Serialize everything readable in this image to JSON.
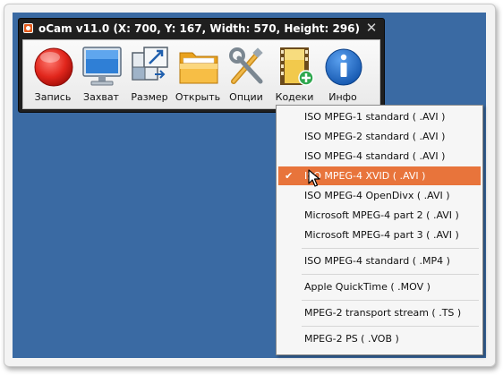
{
  "window": {
    "title": "oCam v11.0 (X: 700, Y: 167, Width: 570, Height: 296)",
    "close_glyph": "✕"
  },
  "toolbar": {
    "buttons": [
      {
        "label": "Запись",
        "icon": "record-icon"
      },
      {
        "label": "Захват",
        "icon": "monitor-icon"
      },
      {
        "label": "Размер",
        "icon": "resize-icon"
      },
      {
        "label": "Открыть",
        "icon": "folder-icon"
      },
      {
        "label": "Опции",
        "icon": "tools-icon"
      },
      {
        "label": "Кодеки",
        "icon": "codec-film-icon"
      },
      {
        "label": "Инфо",
        "icon": "info-icon"
      }
    ]
  },
  "codec_menu": {
    "check_glyph": "✔",
    "items": [
      {
        "label": "ISO MPEG-1 standard ( .AVI )",
        "selected": false
      },
      {
        "label": "ISO MPEG-2 standard ( .AVI )",
        "selected": false
      },
      {
        "label": "ISO MPEG-4 standard ( .AVI )",
        "selected": false
      },
      {
        "label": "ISO MPEG-4 XVID ( .AVI )",
        "selected": true
      },
      {
        "label": "ISO MPEG-4 OpenDivx ( .AVI )",
        "selected": false
      },
      {
        "label": "Microsoft MPEG-4 part 2 ( .AVI )",
        "selected": false
      },
      {
        "label": "Microsoft MPEG-4 part 3 ( .AVI )",
        "selected": false
      },
      {
        "label": "ISO MPEG-4 standard ( .MP4 )",
        "selected": false
      },
      {
        "label": "Apple QuickTime ( .MOV )",
        "selected": false
      },
      {
        "label": "MPEG-2 transport stream ( .TS )",
        "selected": false
      },
      {
        "label": "MPEG-2 PS ( .VOB )",
        "selected": false
      }
    ]
  },
  "colors": {
    "desktop": "#3a6aa3",
    "menu_highlight": "#e8743b",
    "titlebar": "#1f1f1f"
  }
}
